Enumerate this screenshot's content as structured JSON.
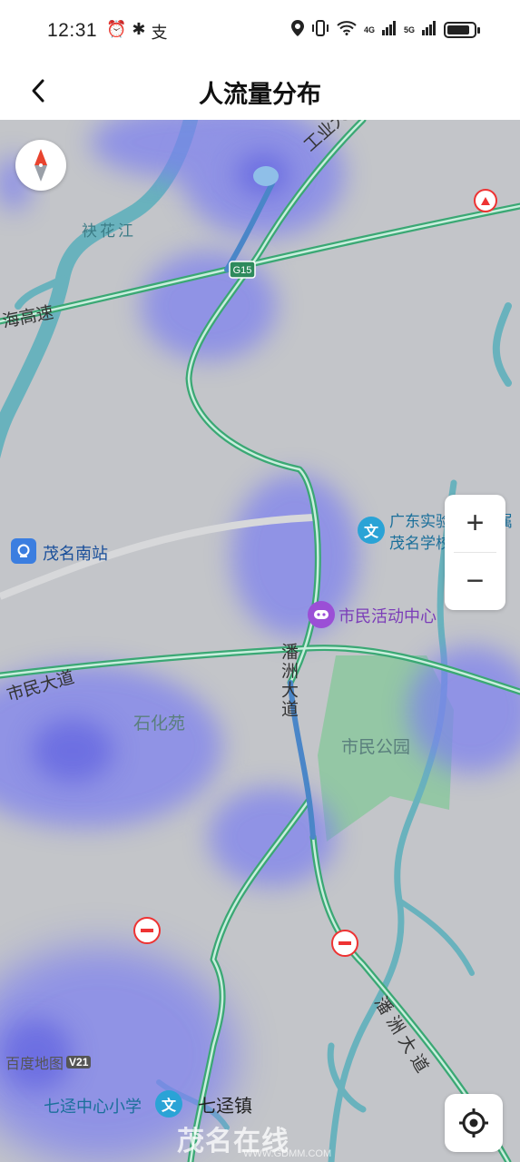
{
  "status_bar": {
    "time": "12:31",
    "left_icons": [
      "alarm-icon",
      "bluetooth-icon",
      "alipay-icon"
    ],
    "network_labels": [
      "4G",
      "5G"
    ],
    "battery_level": 0.85
  },
  "header": {
    "title": "人流量分布"
  },
  "map": {
    "road_labels": {
      "gongye": "工业大道",
      "g15": "G15",
      "expressway": "海高速",
      "shimin": "市民大道",
      "panzhou_upper": "潘洲大道",
      "panzhou_lower": "潘洲大道"
    },
    "water_labels": {
      "river": "袂花江"
    },
    "area_labels": {
      "shihuayuan": "石化苑",
      "shimin_park": "市民公园"
    },
    "pois": {
      "station": "茂名南站",
      "school_line1": "广东实验中学附属",
      "school_line2": "茂名学校初中部",
      "civic_center": "市民活动中心",
      "qijing_school": "七迳中心小学",
      "qijing_town": "七迳镇"
    },
    "brand": {
      "name": "百度地图",
      "version": "V21"
    },
    "watermark": {
      "name": "茂名在线",
      "url": "WWW.GDMM.COM"
    },
    "controls": {
      "zoom_in": "+",
      "zoom_out": "−"
    },
    "colors": {
      "heat": "#7b7ff0",
      "road_green": "#3aa874",
      "road_blue": "#4a86c8",
      "water": "#69b2bd",
      "park": "#8fc6a1"
    }
  }
}
